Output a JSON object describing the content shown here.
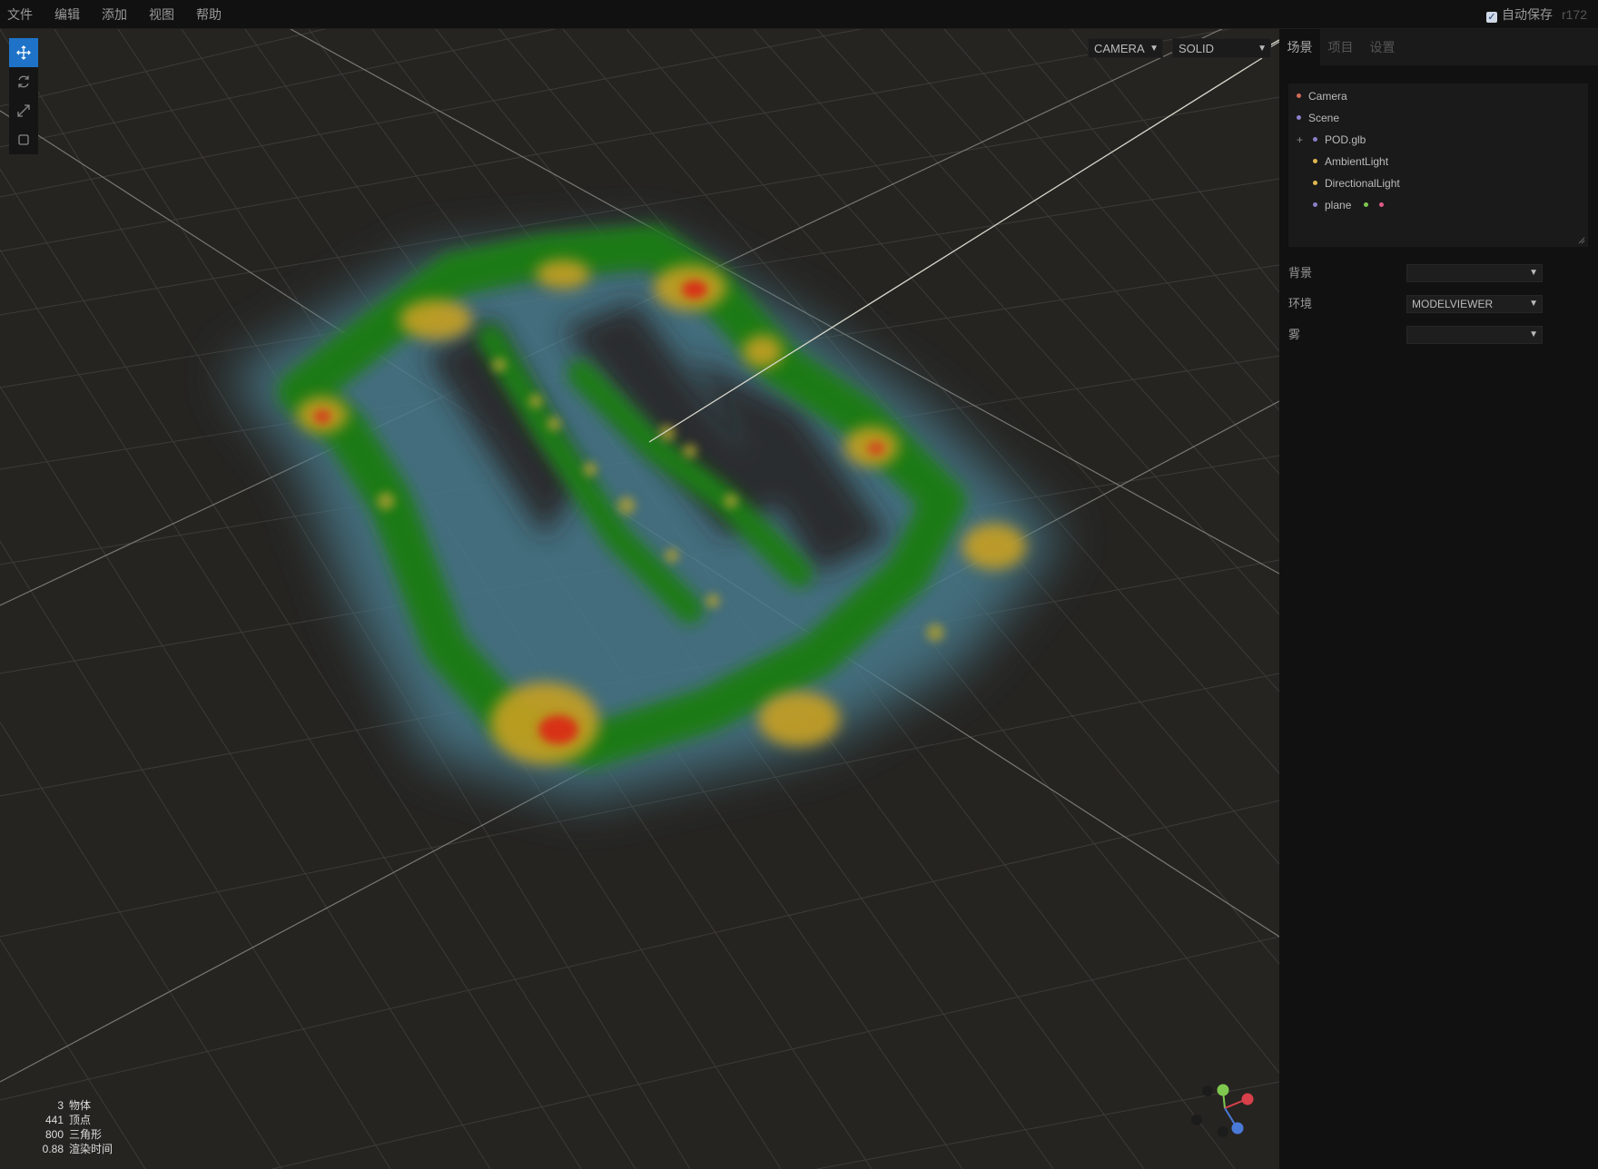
{
  "menubar": {
    "items": [
      "文件",
      "编辑",
      "添加",
      "视图",
      "帮助"
    ],
    "autosave_label": "自动保存",
    "autosave_checked": true,
    "version": "r172"
  },
  "viewport": {
    "camera_select": "CAMERA",
    "shading_select": "SOLID",
    "tools": [
      "move-icon",
      "rotate-icon",
      "scale-icon",
      "square-icon"
    ],
    "heatmap_colors": [
      "#4a7a8c",
      "#1f7a12",
      "#c8a020",
      "#d83018"
    ]
  },
  "stats": [
    {
      "value": "3",
      "label": "物体"
    },
    {
      "value": "441",
      "label": "顶点"
    },
    {
      "value": "800",
      "label": "三角形"
    },
    {
      "value": "0.88",
      "label": "渲染时间"
    }
  ],
  "sidebar": {
    "tabs": [
      "场景",
      "项目",
      "设置"
    ],
    "outliner": [
      {
        "name": "Camera",
        "dot": "#d16a5a"
      },
      {
        "name": "Scene",
        "dot": "#8a7fc8"
      },
      {
        "name": "POD.glb",
        "dot": "#8a7fc8"
      },
      {
        "name": "AmbientLight",
        "dot": "#e0b850"
      },
      {
        "name": "DirectionalLight",
        "dot": "#e0b850"
      },
      {
        "name": "plane",
        "dot": "#8a7fc8",
        "extra_dots": [
          "#7fc84f",
          "#e05a8a"
        ]
      }
    ],
    "props": [
      {
        "label": "背景",
        "value": ""
      },
      {
        "label": "环境",
        "value": "MODELVIEWER"
      },
      {
        "label": "雾",
        "value": ""
      }
    ]
  }
}
